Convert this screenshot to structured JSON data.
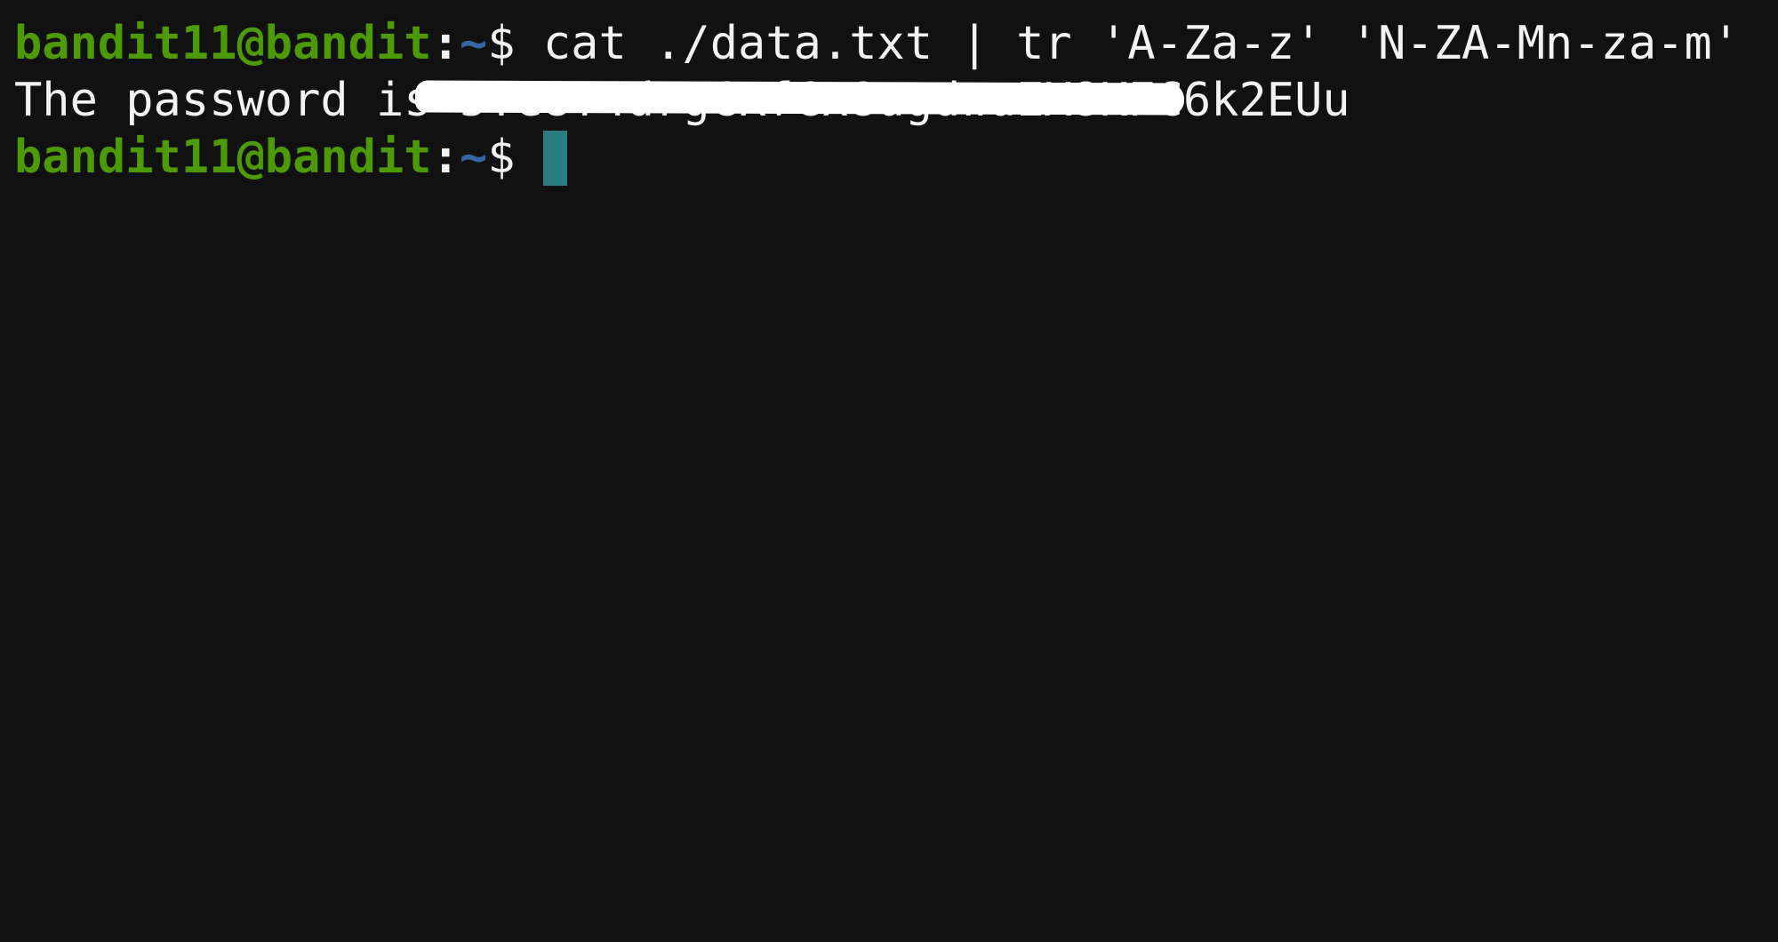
{
  "terminal": {
    "prompt_user_host": "bandit11@bandit",
    "prompt_sep": ":",
    "prompt_path": "~",
    "prompt_dollar": "$",
    "lines": [
      {
        "command": " cat ./data.txt | tr 'A-Za-z' 'N-ZA-Mn-za-m'"
      },
      {
        "output_prefix": "The password is ",
        "output_redacted": "5Te8Y4drgCRfCx8ugdwuEX8KFC6k2EUu"
      },
      {
        "command": " "
      }
    ]
  },
  "colors": {
    "background": "#111112",
    "prompt_user": "#4e9a06",
    "prompt_path": "#3465a4",
    "text": "#f2f2f2",
    "cursor": "#2a7c80",
    "redaction": "#ffffff"
  }
}
